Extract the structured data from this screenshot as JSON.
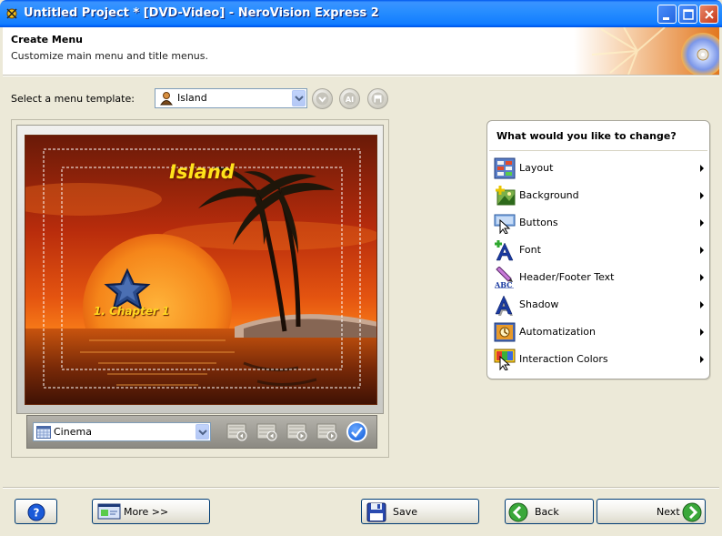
{
  "window": {
    "title": "Untitled Project * [DVD-Video] - NeroVision Express 2"
  },
  "header": {
    "title": "Create Menu",
    "subtitle": "Customize main menu and title menus."
  },
  "template": {
    "label": "Select a menu template:",
    "selected": "Island"
  },
  "preview": {
    "menu_title": "Island",
    "chapter_label": "1. Chapter 1",
    "aspect_selected": "Cinema"
  },
  "panel": {
    "title": "What would you like to change?",
    "items": [
      {
        "label": "Layout",
        "icon": "layout-icon"
      },
      {
        "label": "Background",
        "icon": "background-icon"
      },
      {
        "label": "Buttons",
        "icon": "buttons-icon"
      },
      {
        "label": "Font",
        "icon": "font-icon"
      },
      {
        "label": "Header/Footer Text",
        "icon": "header-footer-text-icon"
      },
      {
        "label": "Shadow",
        "icon": "shadow-icon"
      },
      {
        "label": "Automatization",
        "icon": "automatization-icon"
      },
      {
        "label": "Interaction Colors",
        "icon": "interaction-colors-icon"
      }
    ]
  },
  "footer": {
    "help_icon": "help-icon",
    "more_label": "More >>",
    "save_label": "Save",
    "back_label": "Back",
    "next_label": "Next"
  },
  "colors": {
    "titlebar": "#0a5fe0",
    "menu_title_text": "#ffe21a",
    "panel_border": "#a9a79c"
  }
}
